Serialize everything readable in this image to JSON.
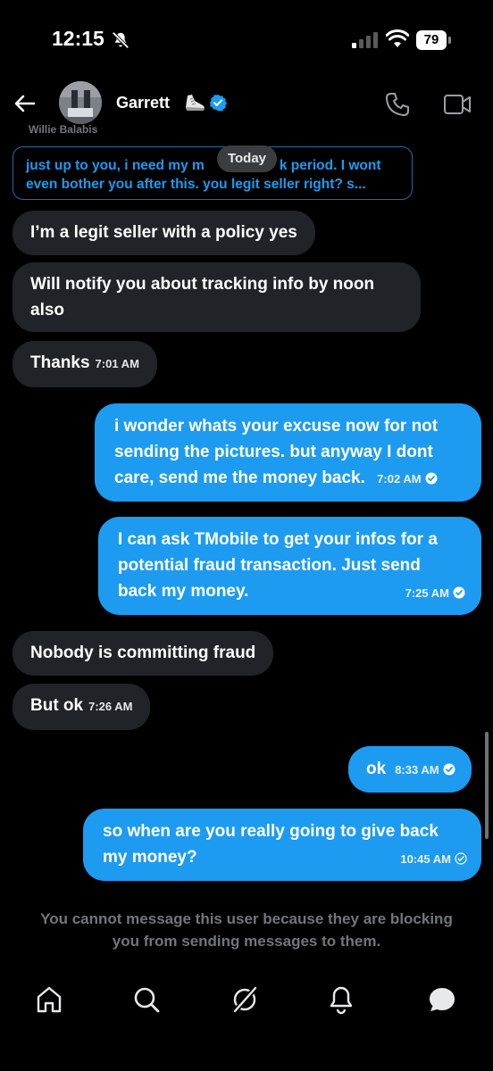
{
  "status_bar": {
    "time": "12:15",
    "battery": "79"
  },
  "header": {
    "contact_name": "Garrett"
  },
  "partial_sender": "Willie Balabis",
  "reply_preview": {
    "text": "just up to you, i need my m",
    "text_hidden_part": "",
    "line1_rest": "k period. I wont",
    "line2": "even bother you after this. you legit seller right? s..."
  },
  "date_chip": "Today",
  "messages": [
    {
      "direction": "in",
      "text": "I’m a legit seller with a policy yes",
      "time": ""
    },
    {
      "direction": "in",
      "text": "Will notify you about tracking info by noon also",
      "time": ""
    },
    {
      "direction": "in",
      "text": "Thanks",
      "time": "7:01 AM"
    },
    {
      "direction": "out",
      "text": "i wonder whats your excuse now for not sending the pictures. but anyway I dont care, send me the money back.",
      "time": "7:02 AM",
      "status": "sent"
    },
    {
      "direction": "out",
      "text": "I can ask TMobile to get your infos for a potential fraud transaction. Just send back my money.",
      "time": "7:25 AM",
      "status": "sent"
    },
    {
      "direction": "in",
      "text": "Nobody is committing fraud",
      "time": ""
    },
    {
      "direction": "in",
      "text": "But ok",
      "time": "7:26 AM"
    },
    {
      "direction": "out",
      "text": "ok",
      "time": "8:33 AM",
      "status": "sent"
    },
    {
      "direction": "out",
      "text": "so when are you really going to give back my money?",
      "time": "10:45 AM",
      "status": "sent-outline"
    }
  ],
  "blocked_notice": "You cannot message this user because they are blocking you from sending messages to them.",
  "nav": [
    "home",
    "search",
    "grok",
    "notifications",
    "messages"
  ],
  "colors": {
    "accent": "#1d9bf0",
    "incoming_bubble": "#202327",
    "background": "#000000",
    "muted_text": "#71767b"
  }
}
